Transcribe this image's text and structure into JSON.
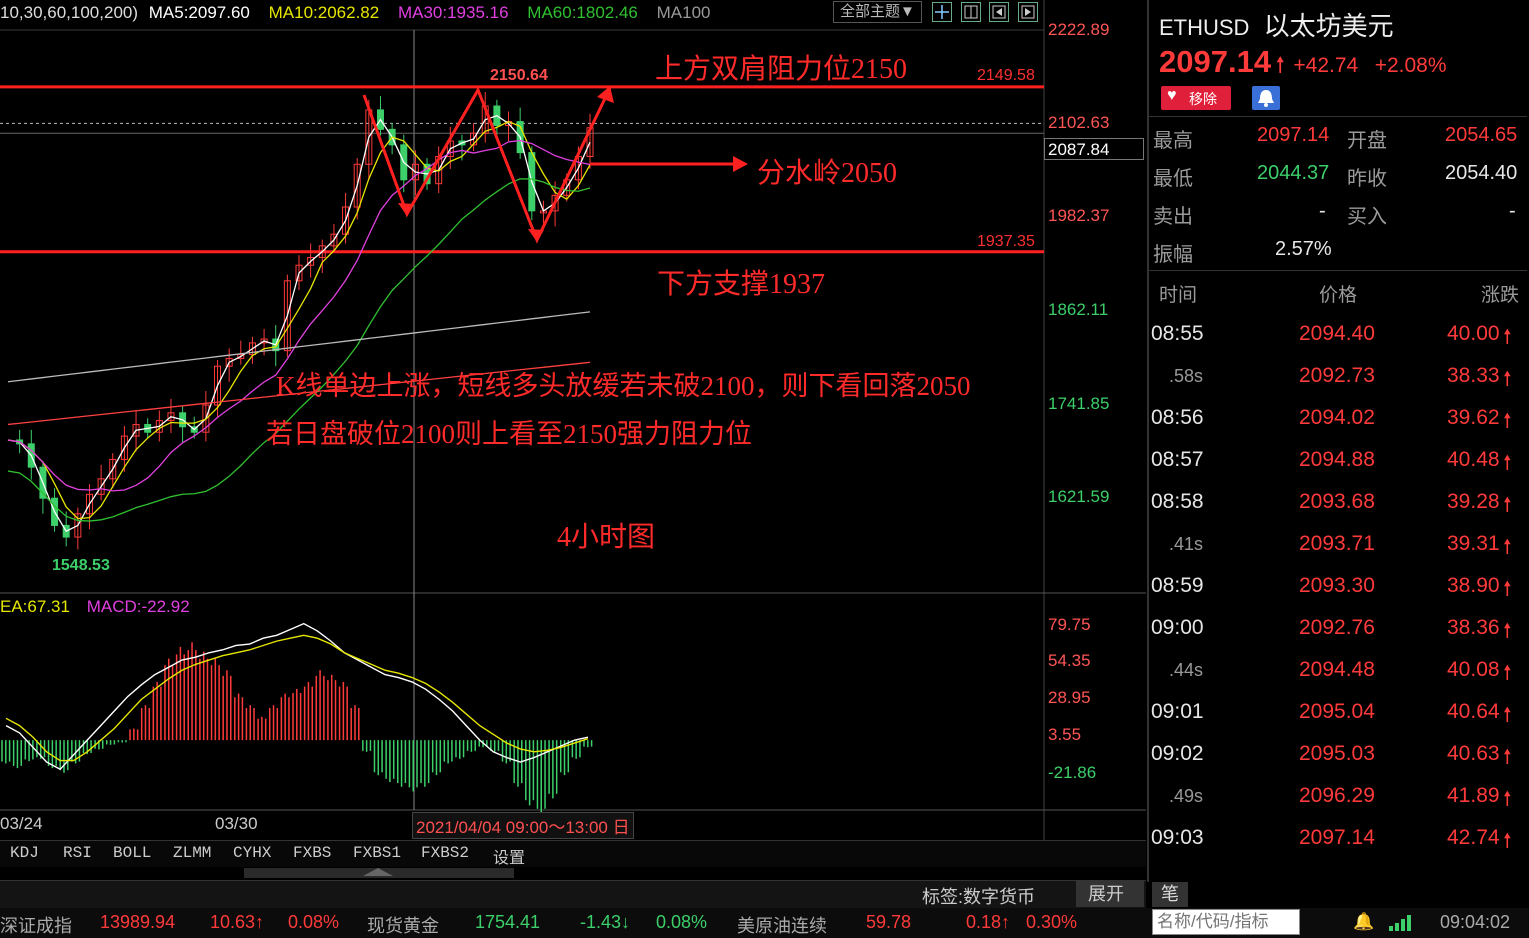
{
  "ma_legend": {
    "periods": "10,30,60,100,200)",
    "ma5": "MA5:2097.60",
    "ma10": "MA10:2062.82",
    "ma30": "MA30:1935.16",
    "ma60": "MA60:1802.46",
    "ma100": "MA100"
  },
  "toolbar": {
    "theme_button": "全部主题▼"
  },
  "price_axis": [
    "2222.89",
    "2102.63",
    "1982.37",
    "1862.11",
    "1741.85",
    "1621.59"
  ],
  "price_current_label": "2087.84",
  "level_labels": {
    "resistance": "2149.58",
    "support": "1937.35",
    "peak": "2150.64",
    "low": "1548.53"
  },
  "annotations": {
    "resistance_text": "上方双肩阻力位2150",
    "pivot_text": "分水岭2050",
    "support_text": "下方支撑1937",
    "comment_line1": "K线单边上涨，短线多头放缓若未破2100，则下看回落2050",
    "comment_line2": "若日盘破位2100则上看至2150强力阻力位",
    "timeframe": "4小时图"
  },
  "macd_legend": {
    "dea": "EA:67.31",
    "macd": "MACD:-22.92"
  },
  "macd_axis": [
    "79.75",
    "54.35",
    "28.95",
    "3.55",
    "-21.86"
  ],
  "date_labels": {
    "d1": "03/24",
    "d2": "03/30",
    "cursor": "2021/04/04 09:00～13:00 日"
  },
  "indicator_tabs": [
    "KDJ",
    "RSI",
    "BOLL",
    "ZLMM",
    "CYHX",
    "FXBS",
    "FXBS1",
    "FXBS2",
    "设置"
  ],
  "chart_data": {
    "type": "candlestick",
    "title": "",
    "timeframe": "4小时图",
    "x_start_label": "03/24",
    "x_mid_label": "03/30",
    "y_range": [
      1548.53,
      2222.89
    ],
    "y_ticks": [
      2222.89,
      2102.63,
      1982.37,
      1862.11,
      1741.85,
      1621.59
    ],
    "horizontal_levels": [
      {
        "value": 2149.58,
        "color": "#ff2020"
      },
      {
        "value": 1937.35,
        "color": "#ff2020"
      },
      {
        "value": 2102.63,
        "style": "dashed"
      }
    ],
    "peak": 2150.64,
    "low": 1548.53,
    "close_path": [
      1695,
      1690,
      1660,
      1620,
      1585,
      1570,
      1600,
      1625,
      1645,
      1670,
      1700,
      1715,
      1705,
      1720,
      1730,
      1712,
      1705,
      1740,
      1790,
      1800,
      1805,
      1820,
      1825,
      1810,
      1900,
      1920,
      1930,
      1945,
      1960,
      1995,
      2050,
      2120,
      2095,
      2075,
      2030,
      2050,
      2025,
      2060,
      2080,
      2075,
      2090,
      2125,
      2100,
      2105,
      2065,
      1990,
      1990,
      2010,
      2030,
      2060,
      2097
    ],
    "ma_series": [
      {
        "name": "MA5",
        "value": 2097.6,
        "color": "#ffffff"
      },
      {
        "name": "MA10",
        "value": 2062.82,
        "color": "#e6e600"
      },
      {
        "name": "MA30",
        "value": 1935.16,
        "color": "#e040e0"
      },
      {
        "name": "MA60",
        "value": 1802.46,
        "color": "#30c030"
      },
      {
        "name": "MA100",
        "color": "#bbbbbb"
      }
    ],
    "macd": {
      "DEA": 67.31,
      "MACD": -22.92,
      "y_ticks": [
        79.75,
        54.35,
        28.95,
        3.55,
        -21.86
      ],
      "hist": [
        -10,
        -12,
        -9,
        -8,
        -12,
        -14,
        -10,
        -6,
        -4,
        -2,
        -1,
        5,
        15,
        25,
        35,
        40,
        42,
        38,
        35,
        30,
        20,
        15,
        10,
        15,
        20,
        22,
        25,
        30,
        28,
        25,
        15,
        -5,
        -15,
        -18,
        -20,
        -22,
        -20,
        -15,
        -10,
        -8,
        -5,
        -3,
        -5,
        -10,
        -20,
        -28,
        -32,
        -25,
        -15,
        -8,
        -3
      ]
    }
  },
  "quote": {
    "symbol": "ETHUSD",
    "name": "以太坊美元",
    "price": "2097.14",
    "change": "+42.74",
    "change_pct": "+2.08%",
    "remove_btn": "移除",
    "high_label": "最高",
    "high": "2097.14",
    "open_label": "开盘",
    "open": "2054.65",
    "low_label": "最低",
    "low": "2044.37",
    "prev_label": "昨收",
    "prev": "2054.40",
    "sell_label": "卖出",
    "sell": "-",
    "buy_label": "买入",
    "buy": "-",
    "amp_label": "振幅",
    "amp": "2.57%"
  },
  "tick_header": {
    "time": "时间",
    "price": "价格",
    "change": "涨跌"
  },
  "ticks": [
    {
      "time": "08:55",
      "price": "2094.40",
      "change": "40.00"
    },
    {
      "time": ".58s",
      "price": "2092.73",
      "change": "38.33"
    },
    {
      "time": "08:56",
      "price": "2094.02",
      "change": "39.62"
    },
    {
      "time": "08:57",
      "price": "2094.88",
      "change": "40.48"
    },
    {
      "time": "08:58",
      "price": "2093.68",
      "change": "39.28"
    },
    {
      "time": ".41s",
      "price": "2093.71",
      "change": "39.31"
    },
    {
      "time": "08:59",
      "price": "2093.30",
      "change": "38.90"
    },
    {
      "time": "09:00",
      "price": "2092.76",
      "change": "38.36"
    },
    {
      "time": ".44s",
      "price": "2094.48",
      "change": "40.08"
    },
    {
      "time": "09:01",
      "price": "2095.04",
      "change": "40.64"
    },
    {
      "time": "09:02",
      "price": "2095.03",
      "change": "40.63"
    },
    {
      "time": ".49s",
      "price": "2096.29",
      "change": "41.89"
    },
    {
      "time": "09:03",
      "price": "2097.14",
      "change": "42.74"
    }
  ],
  "tag_bar": {
    "tag": "标签:数字货币",
    "expand": "展开 ≛",
    "pen": "笔"
  },
  "bottom_bar": {
    "index1": "深证成指",
    "v1": "13989.94",
    "c1": "10.63↑",
    "p1": "0.08%",
    "index2": "现货黄金",
    "v2": "1754.41",
    "c2": "-1.43↓",
    "p2": "0.08%",
    "index3": "美原油连续",
    "v3": "59.78",
    "c3": "0.18↑",
    "p3": "0.30%",
    "search_placeholder": "名称/代码/指标",
    "clock": "09:04:02"
  },
  "colors": {
    "up": "#ff3a3a",
    "down": "#3ccf6a",
    "ma5": "#ffffff",
    "ma10": "#e6e600",
    "ma30": "#e040e0",
    "ma60": "#30c030",
    "ma200": "#ff4040"
  }
}
